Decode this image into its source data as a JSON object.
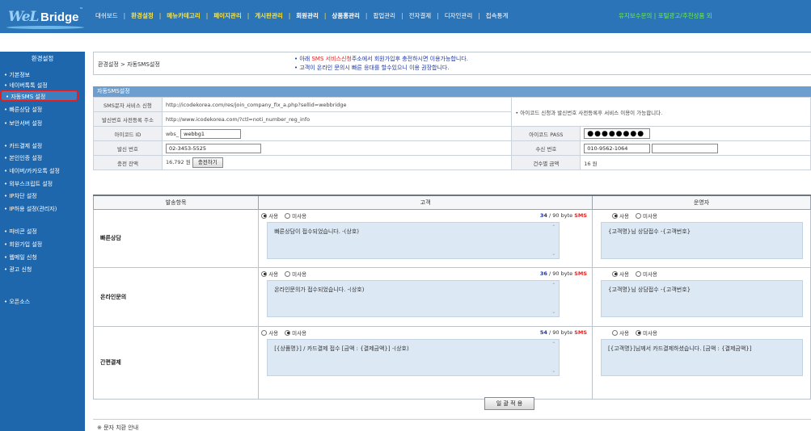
{
  "logo": {
    "part1": "WeL",
    "part2": "Bridge"
  },
  "topnav": [
    {
      "label": "대쉬보드",
      "style": "normal"
    },
    {
      "label": "환경설정",
      "style": "hl"
    },
    {
      "label": "메뉴카테고리",
      "style": "hl"
    },
    {
      "label": "페이지관리",
      "style": "hl"
    },
    {
      "label": "게시판관리",
      "style": "hl"
    },
    {
      "label": "회원관리",
      "style": "bold"
    },
    {
      "label": "상품홍관리",
      "style": "bold"
    },
    {
      "label": "팝업관리",
      "style": "normal"
    },
    {
      "label": "전자결제",
      "style": "normal"
    },
    {
      "label": "디자인관리",
      "style": "normal"
    },
    {
      "label": "접속통계",
      "style": "normal"
    }
  ],
  "toplinks": "유지보수문의 | 포털광고/추천상품 외",
  "sidebar": {
    "title": "환경설정",
    "items": [
      "• 기본정보",
      "• 네이버톡톡 설정",
      "• 자동SMS 설정",
      "• 빠른상담 설정",
      "• 보안서버 설정",
      "• 카드결제 설정",
      "• 본인인증 설정",
      "• 네이버/카카오톡 설정",
      "• 외부스크립트 설정",
      "• IP차단 설정",
      "• IP허용 설정(관리자)",
      "• 파비콘 설정",
      "• 회원가입 설정",
      "• 웹메일 신청",
      "• 광고 신청",
      "• 오픈소스"
    ]
  },
  "breadcrumb": "환경설정 > 자동SMS설정",
  "notice": {
    "line1_pre": "• 아래 ",
    "line1_red": "SMS 서비스신청",
    "line1_post": "주소에서 회원가입후 충전하시면 이용가능합니다.",
    "line2": "• 고객이 온라인 문의시 빠른 응대를 할수있으니 이용 권장합니다."
  },
  "section_title": "자동SMS설정",
  "info": {
    "sms_service_label": "SMS문자 서비스 신청",
    "sms_service_url": "http://icodekorea.com/res/join_company_fix_a.php?sellid=webbridge",
    "sender_reg_label": "발신번호 사전등록 주소",
    "sender_reg_url": "http://www.icodekorea.com/?ctl=noti_number_reg_info",
    "right_note": "• 아이코드 신청과 발신번호 사전등록후 서비스 이용이 가능합니다.",
    "icode_id_label": "아이코드 ID",
    "icode_id_prefix": "wbs_",
    "icode_id_value": "webbg1",
    "icode_pass_label": "아이코드 PASS",
    "icode_pass_value": "●●●●●●●●",
    "sender_label": "발신 번호",
    "sender_value": "02-3453-5525",
    "receiver_label": "수신 번호",
    "receiver_value": "010-9562-1064",
    "receiver_value2": "",
    "balance_label": "충전 잔액",
    "balance_value": "16,792 원",
    "charge_button": "충전하기",
    "per_price_label": "건수별 금액",
    "per_price_value": "16 원"
  },
  "sms_table": {
    "headers": [
      "발송항목",
      "고객",
      "운영자"
    ],
    "use_label": "사용",
    "nouse_label": "미사용",
    "byte_suffix": " / 90 byte ",
    "sms_tag": "SMS",
    "rows": [
      {
        "name": "빠른상담",
        "customer_use": true,
        "customer_bytes": "34",
        "customer_msg": "빠른상담이 접수되었습니다. -(상호)",
        "operator_use": true,
        "operator_msg": "{고객명}님 상담접수 -{고객번호}"
      },
      {
        "name": "온라인문의",
        "customer_use": true,
        "customer_bytes": "36",
        "customer_msg": "온라인문의가 접수되었습니다. -(상호)",
        "operator_use": true,
        "operator_msg": "{고객명}님 상담접수 -{고객번호}"
      },
      {
        "name": "간편결제",
        "customer_use": false,
        "customer_bytes": "54",
        "customer_msg": "[{상품명}] / 카드결제 접수 [금액 : {결제금액}] -(상호)",
        "operator_use": false,
        "operator_msg": "[{고객명}]님께서 카드결제하셨습니다. [금액 : {결제금액}]"
      }
    ]
  },
  "apply_button": "일 괄 적 용",
  "footer_note": "※ 문자 치환 안내",
  "colors": {
    "topbar": "#2b74b8",
    "sidebar": "#1e67ad",
    "highlight": "#e81c1c",
    "section_head": "#6c9ed0"
  }
}
